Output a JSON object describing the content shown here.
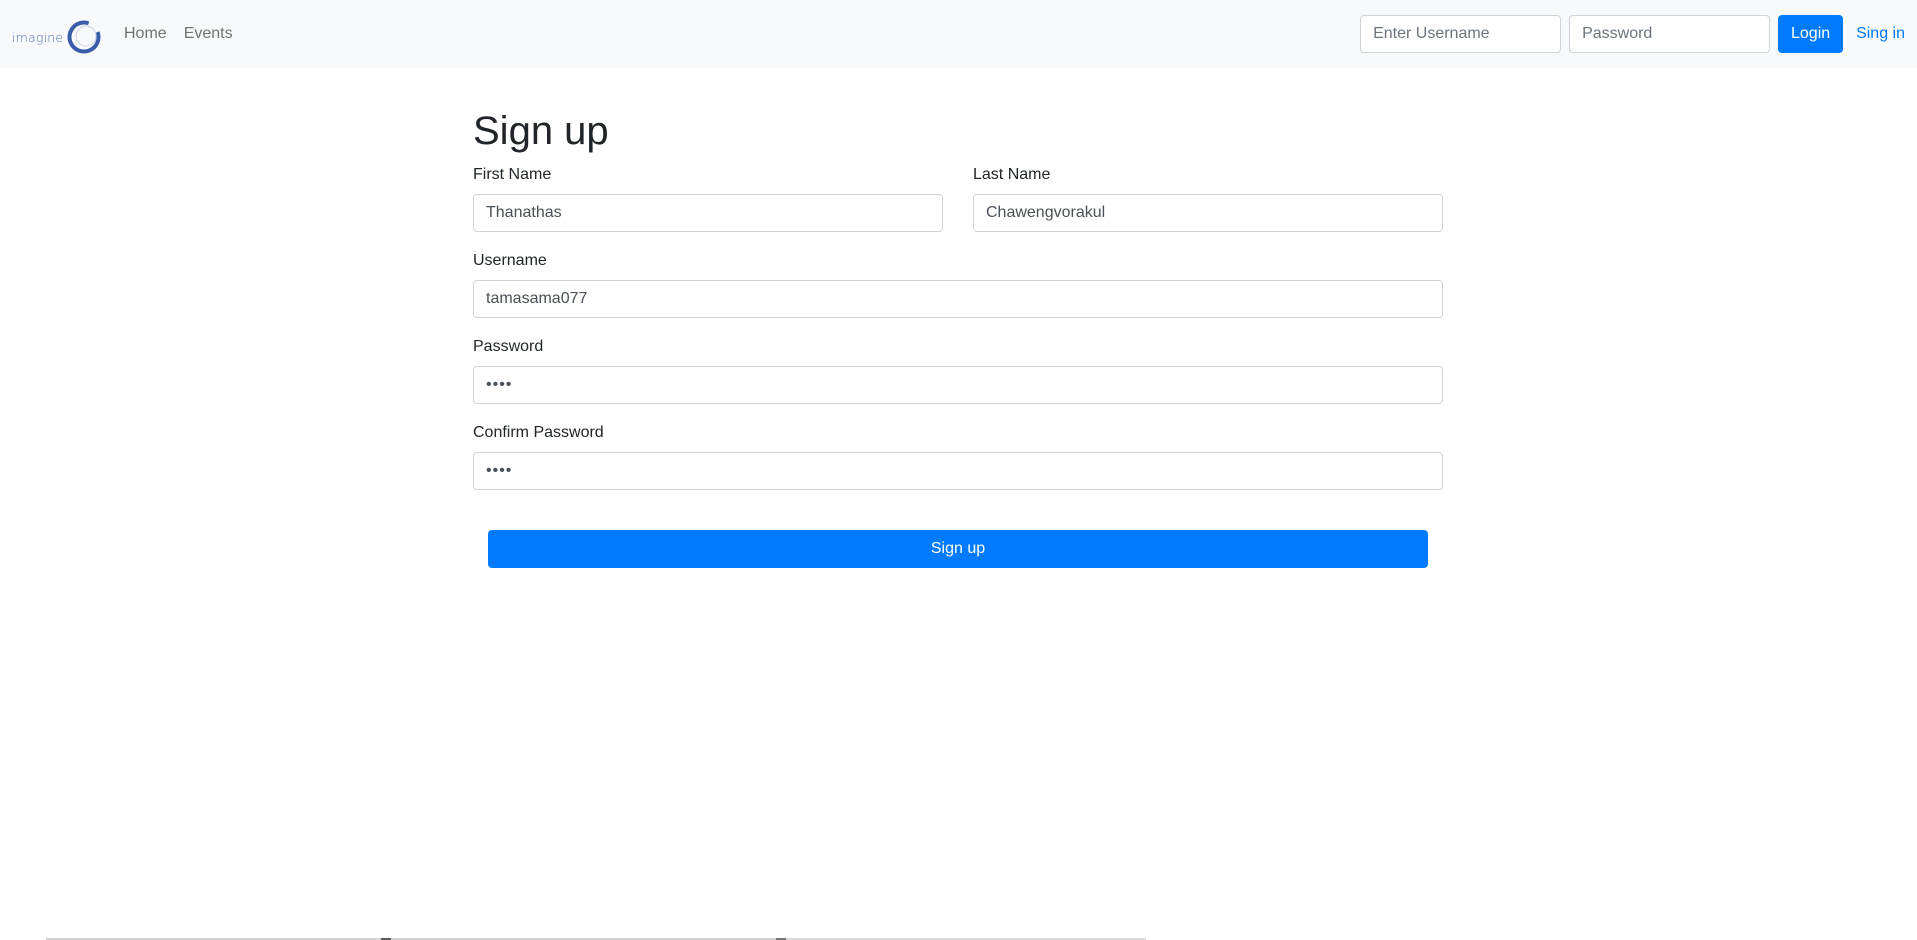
{
  "navbar": {
    "brand": {
      "text": "imagine",
      "icon": "ring-logo-icon",
      "color": "#3b5bab"
    },
    "links": [
      {
        "label": "Home"
      },
      {
        "label": "Events"
      }
    ],
    "login_form": {
      "username_placeholder": "Enter Username",
      "username_value": "",
      "password_placeholder": "Password",
      "password_value": "",
      "login_label": "Login",
      "signin_label": "Sing in"
    }
  },
  "signup": {
    "title": "Sign up",
    "first_name": {
      "label": "First Name",
      "value": "Thanathas"
    },
    "last_name": {
      "label": "Last Name",
      "value": "Chawengvorakul"
    },
    "username": {
      "label": "Username",
      "value": "tamasama077"
    },
    "password": {
      "label": "Password",
      "value": "••••"
    },
    "confirm_password": {
      "label": "Confirm Password",
      "value": "••••"
    },
    "submit_label": "Sign up"
  },
  "colors": {
    "primary": "#007bff",
    "navbar_bg": "#f8f9fa",
    "text": "#212529",
    "muted_link": "#6c757d"
  }
}
